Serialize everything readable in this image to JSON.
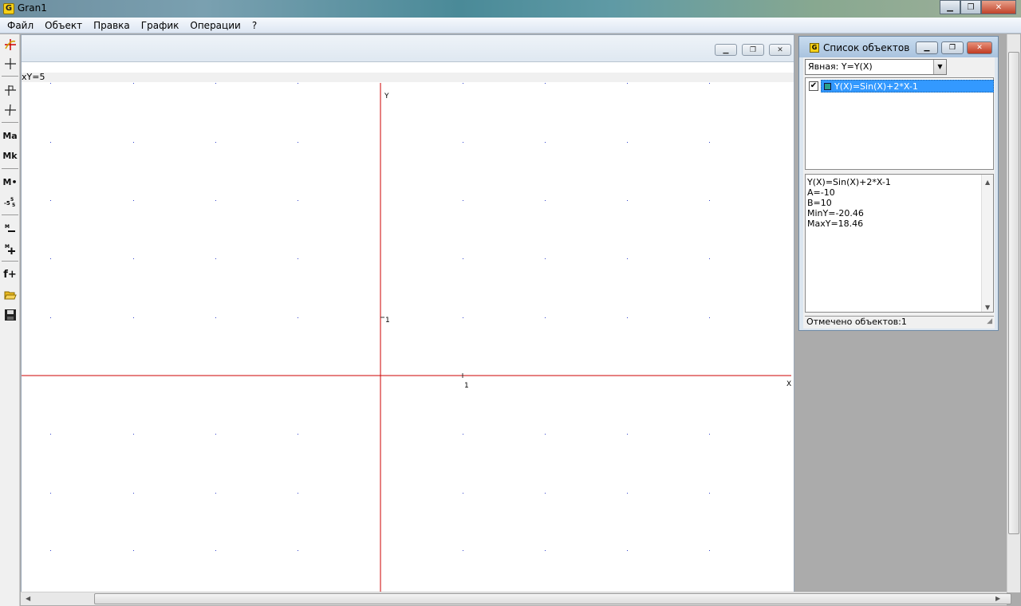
{
  "window": {
    "title": "Gran1",
    "icon_letter": "G"
  },
  "menu": [
    "Файл",
    "Объект",
    "Правка",
    "График",
    "Операции",
    "?"
  ],
  "graph": {
    "coord_text": "xY=5",
    "y_axis_label": "Y",
    "x_axis_label": "X",
    "x_unit_label": "1",
    "y_unit_label": "1"
  },
  "object_panel": {
    "title": "Список объектов",
    "icon_letter": "G",
    "type_select": "Явная: Y=Y(X)",
    "objects": [
      {
        "label": "Y(X)=Sin(X)+2*X-1",
        "checked": true,
        "color": "#2aa08a"
      }
    ],
    "info_lines": [
      "Y(X)=Sin(X)+2*X-1",
      "A=-10",
      "B=10",
      "MinY=-20.46",
      "MaxY=18.46"
    ],
    "status": "Отмечено объектов:1"
  },
  "toolbar": {
    "tools": [
      "axes-icon",
      "cross-icon",
      "axis-pin-icon",
      "cross-thin-icon",
      "ma-icon",
      "mk-icon",
      "m-dot-icon",
      "scale-icon",
      "m-minus-icon",
      "m-plus-icon",
      "f-plus-icon",
      "open-folder-icon",
      "save-disk-icon"
    ],
    "labels": {
      "ma": "Ma",
      "mk": "Mk",
      "mdot": "M•",
      "fplus": "f+"
    }
  },
  "colors": {
    "axis": "#cc0000",
    "grid_dot": "#3344cc",
    "selection": "#3399ff"
  }
}
